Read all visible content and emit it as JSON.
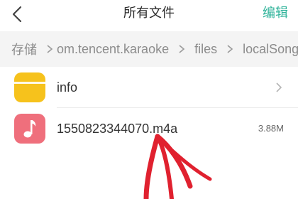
{
  "header": {
    "title": "所有文件",
    "edit_label": "编辑"
  },
  "breadcrumb": {
    "items": [
      "存储",
      "om.tencent.karaoke",
      "files",
      "localSong"
    ]
  },
  "files": [
    {
      "name": "info",
      "icon": "folder-icon",
      "icon_color": "#f6c21c"
    },
    {
      "name": "1550823344070.m4a",
      "size": "3.88M",
      "icon": "music-note-icon",
      "icon_color": "#ef6f7c"
    }
  ],
  "colors": {
    "accent": "#2fb39a",
    "annotation": "#e0212f"
  }
}
